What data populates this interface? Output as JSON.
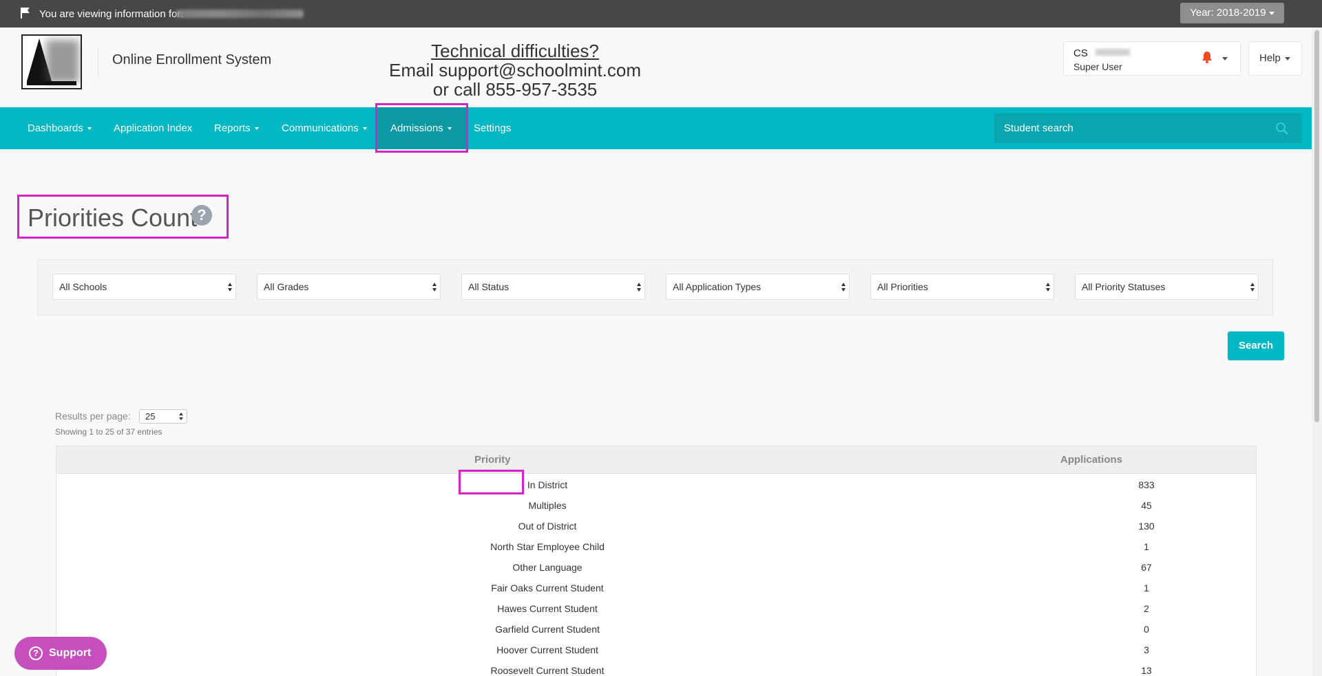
{
  "topbar": {
    "viewing_label": "You are viewing information for:",
    "year_label": "Year:",
    "year_value": "2018-2019"
  },
  "header": {
    "app_name": "Online Enrollment System",
    "tech_line1": "Technical difficulties?",
    "tech_line2": "Email support@schoolmint.com",
    "tech_line3": "or call 855-957-3535",
    "user_initials": "CS",
    "user_role": "Super User",
    "help_label": "Help"
  },
  "nav": {
    "items": [
      {
        "label": "Dashboards",
        "dropdown": true
      },
      {
        "label": "Application Index",
        "dropdown": false
      },
      {
        "label": "Reports",
        "dropdown": true
      },
      {
        "label": "Communications",
        "dropdown": true
      },
      {
        "label": "Admissions",
        "dropdown": true,
        "active": true
      },
      {
        "label": "Settings",
        "dropdown": false
      }
    ],
    "search_placeholder": "Student search"
  },
  "page": {
    "title": "Priorities Count",
    "help_icon": "?"
  },
  "filters": {
    "schools": "All Schools",
    "grades": "All Grades",
    "status": "All Status",
    "application_types": "All Application Types",
    "priorities": "All Priorities",
    "priority_statuses": "All Priority Statuses"
  },
  "search_button": "Search",
  "results": {
    "per_page_label": "Results per page:",
    "per_page_value": "25",
    "showing": "Showing 1 to 25 of 37 entries"
  },
  "table": {
    "headers": {
      "priority": "Priority",
      "applications": "Applications"
    },
    "rows": [
      {
        "priority": "In District",
        "applications": "833"
      },
      {
        "priority": "Multiples",
        "applications": "45"
      },
      {
        "priority": "Out of District",
        "applications": "130"
      },
      {
        "priority": "North Star Employee Child",
        "applications": "1"
      },
      {
        "priority": "Other Language",
        "applications": "67"
      },
      {
        "priority": "Fair Oaks Current Student",
        "applications": "1"
      },
      {
        "priority": "Hawes Current Student",
        "applications": "2"
      },
      {
        "priority": "Garfield Current Student",
        "applications": "0"
      },
      {
        "priority": "Hoover Current Student",
        "applications": "3"
      },
      {
        "priority": "Roosevelt Current Student",
        "applications": "13"
      }
    ]
  },
  "support_label": "Support",
  "colors": {
    "topbar": "#474747",
    "nav": "#00b8c4",
    "nav_active": "#0b9aa3",
    "highlight": "#d622c9",
    "support": "#c64fbd"
  }
}
